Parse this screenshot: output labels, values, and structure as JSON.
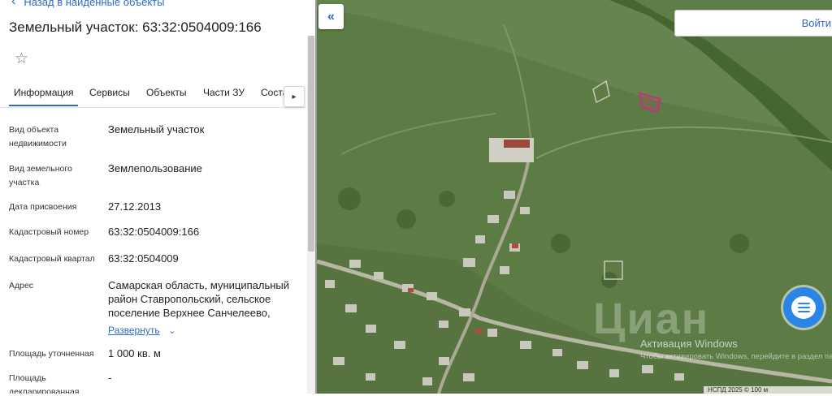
{
  "panel": {
    "back_link": "Назад в найденные объекты",
    "title": "Земельный участок: 63:32:0504009:166",
    "tabs": [
      "Информация",
      "Сервисы",
      "Объекты",
      "Части ЗУ",
      "Состав"
    ],
    "rows": [
      {
        "label": "Вид объекта недвижимости",
        "value": "Земельный участок"
      },
      {
        "label": "Вид земельного участка",
        "value": "Землепользование"
      },
      {
        "label": "Дата присвоения",
        "value": "27.12.2013"
      },
      {
        "label": "Кадастровый номер",
        "value": "63:32:0504009:166"
      },
      {
        "label": "Кадастровый квартал",
        "value": "63:32:0504009"
      },
      {
        "label": "Адрес",
        "value": "Самарская область, муниципальный район Ставропольский, сельское поселение Верхнее Санчелеево,"
      },
      {
        "label": "Площадь уточненная",
        "value": "1 000 кв. м"
      },
      {
        "label": "Площадь декларированная",
        "value": "-"
      }
    ],
    "expand_label": "Развернуть"
  },
  "map": {
    "login_label": "Войти",
    "watermark": "Циан",
    "activation_title": "Активация Windows",
    "activation_text": "Чтобы активировать Windows, перейдите в раздел параметры компьютера.",
    "attribution": "НСПД 2025 © 100 м"
  },
  "icons": {
    "back": "chevron-left-icon",
    "star": "star-icon",
    "tab_next": "chevron-right-icon",
    "expand": "chevron-down-icon",
    "collapse": "double-chevron-left-icon",
    "chat": "chat-icon"
  },
  "colors": {
    "accent": "#2e69c9",
    "chat": "#2a86e6",
    "parcel_outline": "#c2337a"
  }
}
